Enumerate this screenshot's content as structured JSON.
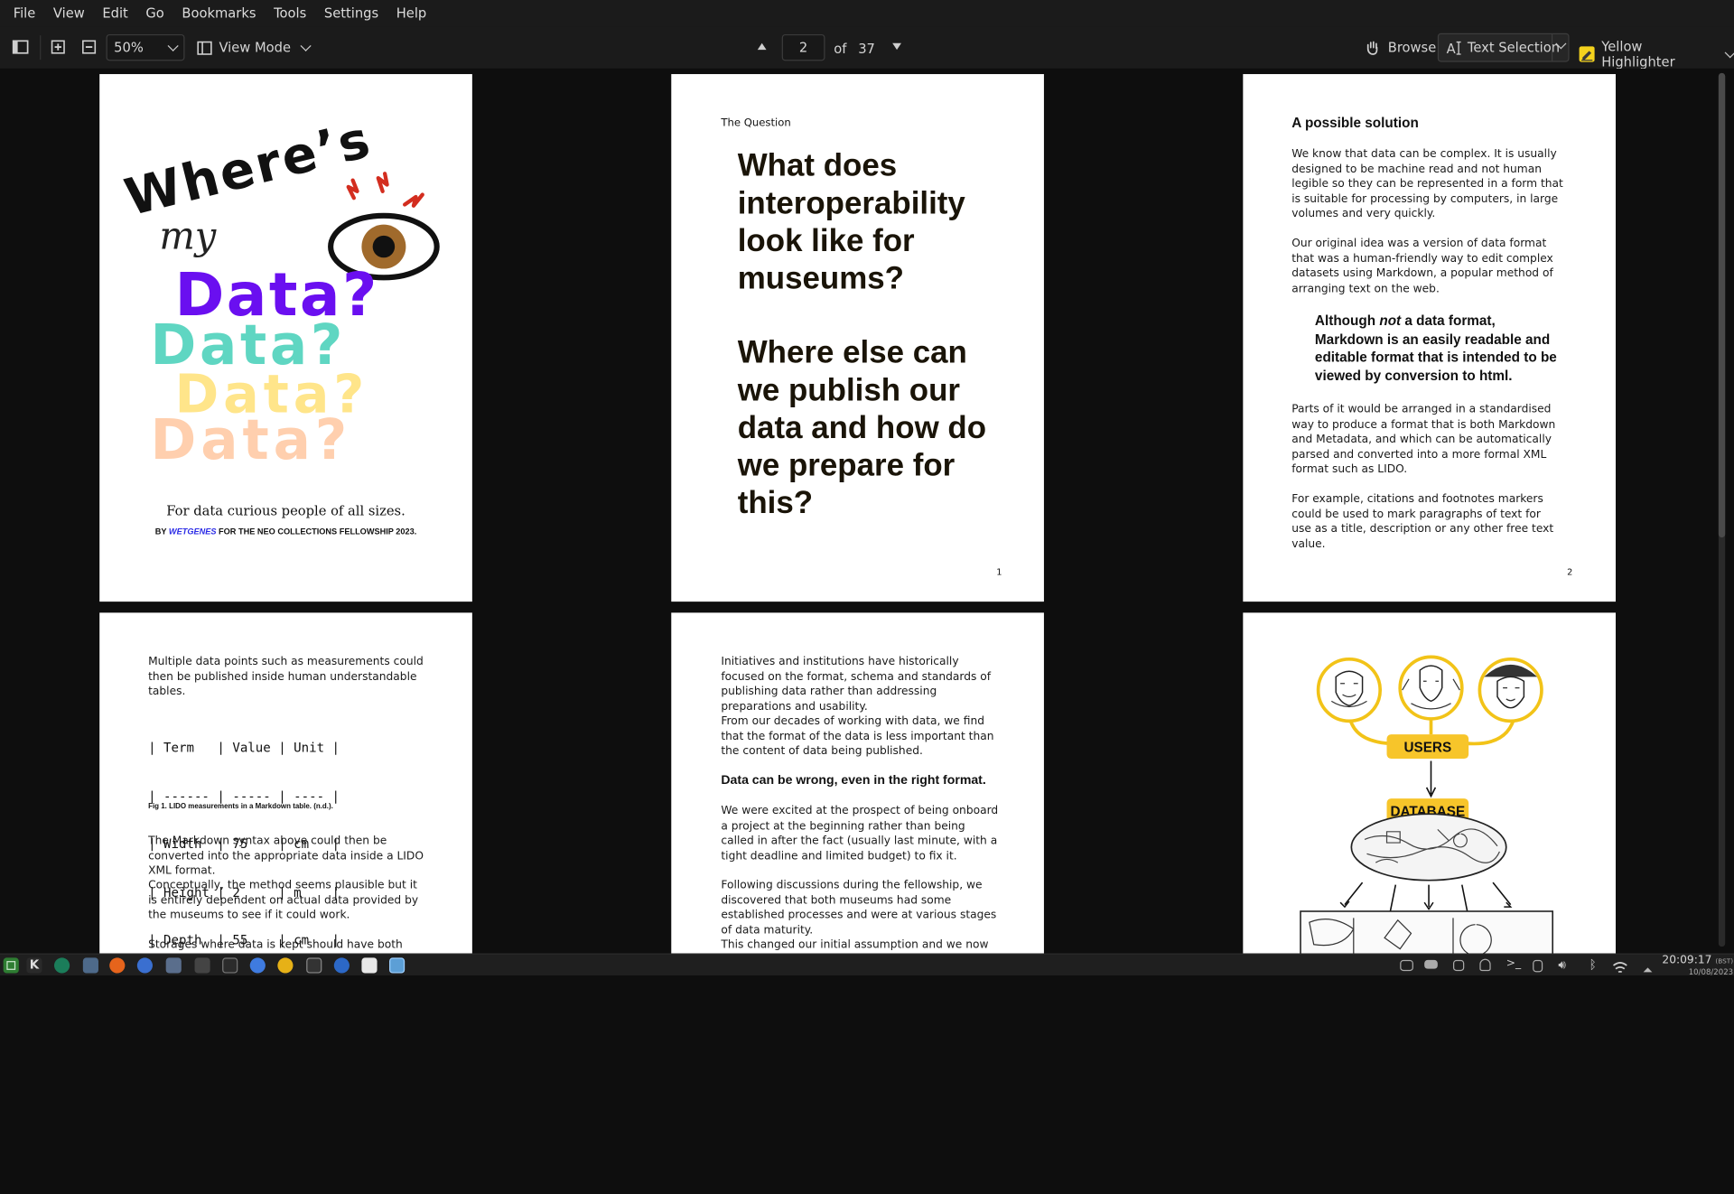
{
  "menubar": {
    "items": [
      "File",
      "View",
      "Edit",
      "Go",
      "Bookmarks",
      "Tools",
      "Settings",
      "Help"
    ]
  },
  "toolbar": {
    "zoom": "50%",
    "view_mode": "View Mode",
    "page_current": "2",
    "page_of": "of",
    "page_total": "37",
    "browse": "Browse",
    "text_selection": "Text Selection",
    "highlighter": "Yellow Highlighter"
  },
  "pages": {
    "p1": {
      "title_words": [
        "Where’s",
        "my",
        "Data?",
        "Data?",
        "Data?",
        "Data?"
      ],
      "tagline": "For data curious people of all sizes.",
      "credit_by": "BY",
      "credit_author": "WETGENES",
      "credit_rest": "FOR THE NEO COLLECTIONS FELLOWSHIP 2023."
    },
    "p2": {
      "section": "The Question",
      "q1": "What does interoperability look like for museums?",
      "q2": "Where else can we publish our data and how do we prepare for this?",
      "page_no": "1"
    },
    "p3": {
      "heading": "A possible solution",
      "para1": "We know that data can be complex. It is usually designed to be machine read and not human legible so they can be represented in a form that is suitable for processing by computers, in large volumes and very quickly.",
      "para2": "Our original idea was a version of data format that was a human-friendly way to edit complex datasets using Markdown, a popular method of arranging text on the web.",
      "quote_a": "Although ",
      "quote_em": "not",
      "quote_b": " a data format, Markdown is an easily readable and editable format that is intended to be viewed by conversion to html.",
      "para3": "Parts of it would be arranged in a standardised way to produce a format that is both Markdown and Metadata, and which can be automatically parsed and converted into a more formal XML format such as LIDO.",
      "para4": "For example, citations and footnotes markers could be used to mark paragraphs of text for use as a title, description or any other free text value.",
      "page_no": "2"
    },
    "p4": {
      "intro": "Multiple data points such as measurements could then be published inside human understandable tables.",
      "table_lines": [
        "| Term   | Value | Unit |",
        "| ------ | ----- | ---- |",
        "| Width  | 75    | cm   |",
        "| Height | 2     | m    |",
        "| Depth  | 55    | cm   |"
      ],
      "caption": "Fig 1. LIDO measurements in a Markdown table. (n.d.).",
      "para1": "The Markdown syntax above could then be converted into the appropriate data inside a LIDO XML format.",
      "para2": "Conceptually, the method seems plausible but it is entirely dependent on actual data provided by the museums to see if it could work.",
      "para3": "Storages where data is kept should have both import"
    },
    "p5": {
      "para1": "Initiatives and institutions have historically focused on the format, schema and standards of publishing data rather than addressing preparations and usability.",
      "para2": "From our decades of working with data, we find that the format of the data is less important than the content of data being published.",
      "heading": "Data can be wrong, even in the right format.",
      "para3": "We were excited at the prospect of being onboard a project at the beginning rather than being called in after the fact (usually last minute, with a tight deadline and limited budget) to fix it.",
      "para4": "Following discussions during the fellowship, we discovered that both museums had some established processes and were at various stages of data maturity.",
      "para5": "This changed our initial assumption and we now"
    },
    "p6": {
      "users_label": "USERS",
      "database_label": "DATABASE"
    }
  },
  "taskbar": {
    "time": "20:09:17",
    "tz": "(BST)",
    "date": "10/08/2023"
  },
  "colors": {
    "purple": "#6a0ff0",
    "teal": "#5fd6c2",
    "yellow": "#ffe58a",
    "peach": "#ffcfae",
    "badge": "#f7c52a"
  }
}
